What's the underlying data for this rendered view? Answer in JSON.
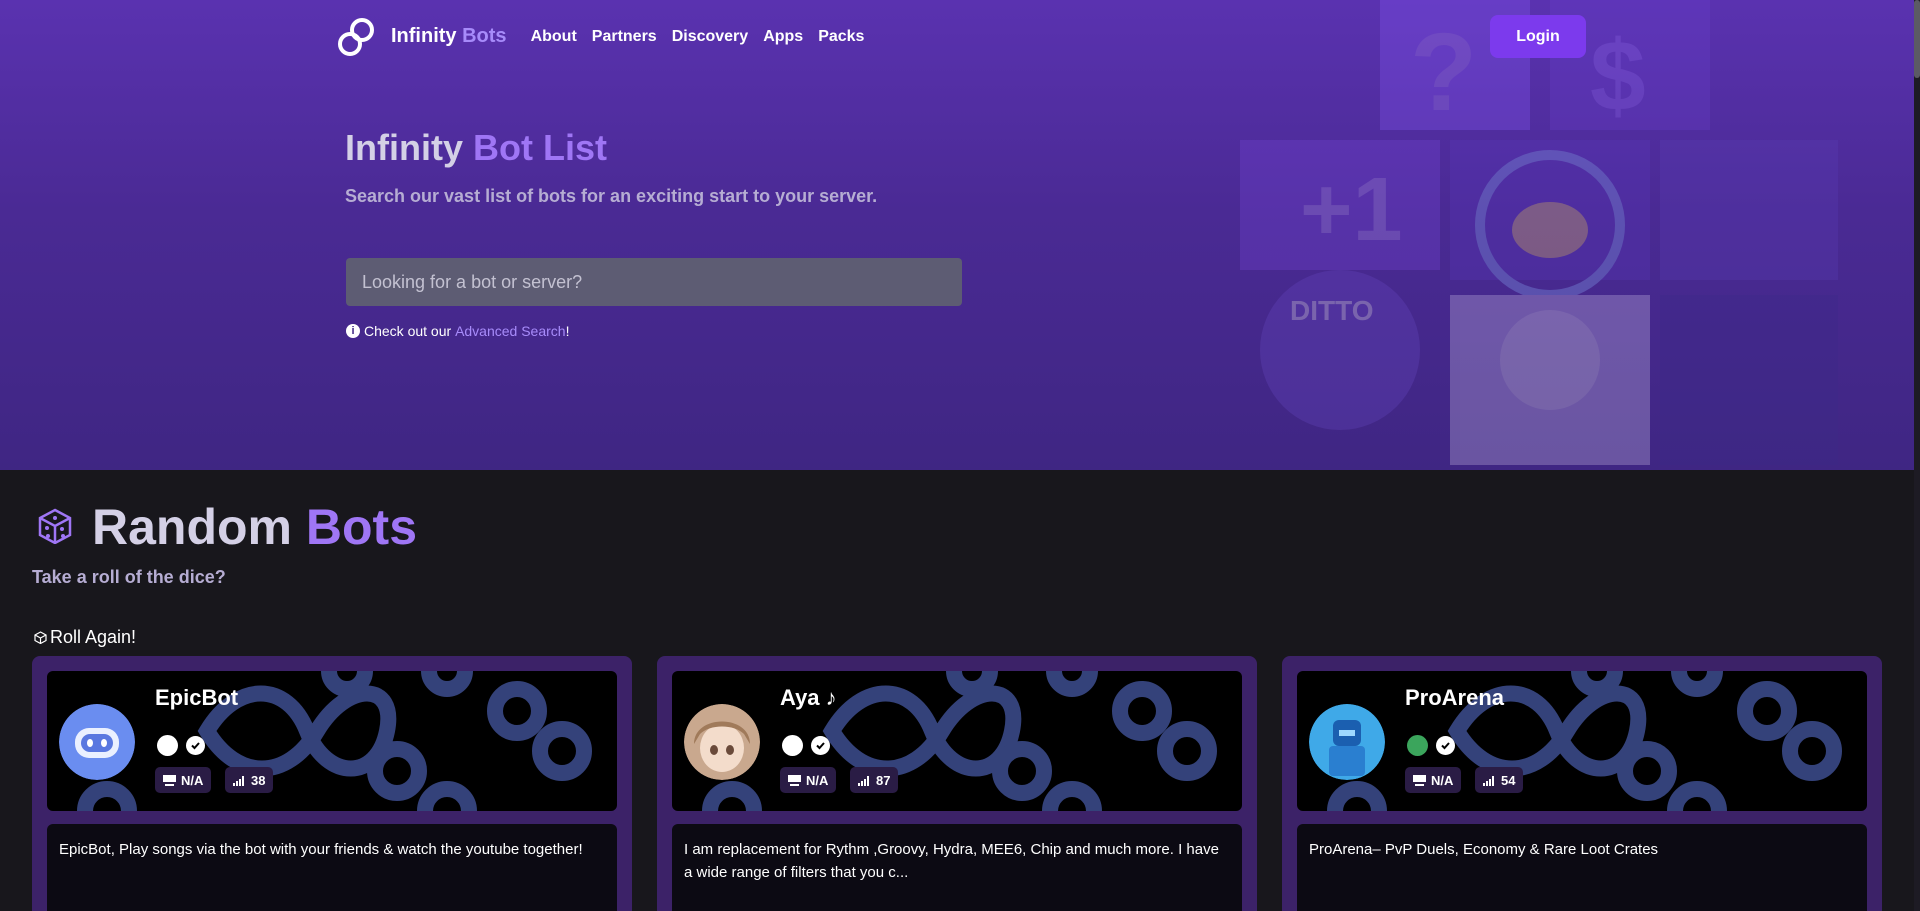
{
  "nav": {
    "brand": "Infinity",
    "brand_accent": "Bots",
    "links": [
      "About",
      "Partners",
      "Discovery",
      "Apps",
      "Packs"
    ],
    "login": "Login"
  },
  "hero": {
    "title": "Infinity",
    "title_accent": "Bot List",
    "subtitle": "Search our vast list of bots for an exciting start to your server.",
    "search_placeholder": "Looking for a bot or server?",
    "advanced_prefix": "Check out our",
    "advanced_link": "Advanced Search",
    "advanced_suffix": "!"
  },
  "random": {
    "title": "Random",
    "title_accent": "Bots",
    "subtitle": "Take a roll of the dice?",
    "roll": "Roll Again!"
  },
  "bots": [
    {
      "name": "EpicBot",
      "status_color": "#ffffff",
      "shards": "N/A",
      "servers": "38",
      "description": "EpicBot, Play songs via the bot with your friends & watch the youtube together!"
    },
    {
      "name": "Aya ♪",
      "status_color": "#ffffff",
      "shards": "N/A",
      "servers": "87",
      "description": "I am replacement for Rythm ,Groovy, Hydra, MEE6, Chip and much more. I have a wide range of filters that you c..."
    },
    {
      "name": "ProArena",
      "status_color": "#3ba55c",
      "shards": "N/A",
      "servers": "54",
      "description": "ProArena– PvP Duels, Economy & Rare Loot Crates"
    }
  ],
  "colors": {
    "accent": "#9f76f5",
    "button": "#7c3aed",
    "card": "#3c2268"
  }
}
